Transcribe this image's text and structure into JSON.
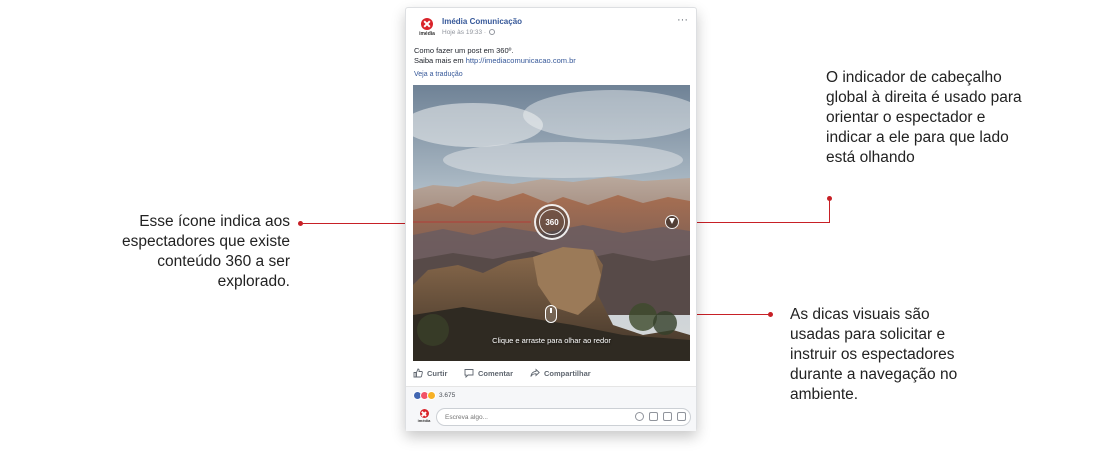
{
  "annotations": {
    "left": "Esse ícone indica aos espectadores que existe conteúdo 360 a ser explorado.",
    "top_right": "O indicador de cabeçalho global à direita é usado para orientar o espectador e indicar a ele para que lado está olhando",
    "bottom_right": "As dicas visuais são usadas para solicitar e instruir os espectadores durante a navegação no ambiente."
  },
  "post": {
    "avatar_brand": "imédia",
    "page_name": "Imédia Comunicação",
    "time": "Hoje às 19:33 · ",
    "more": "···",
    "text_line1": "Como fazer um post em 360º.",
    "text_line2_prefix": "Saiba mais em ",
    "link": "http://imediacomunicacao.com.br",
    "translate": "Veja a tradução"
  },
  "media": {
    "badge": "360",
    "hint": "Clique e arraste para olhar ao redor"
  },
  "actions": {
    "like": "Curtir",
    "comment": "Comentar",
    "share": "Compartilhar"
  },
  "reactions": {
    "count": "3.675"
  },
  "comment": {
    "placeholder": "Escreva algo..."
  },
  "colors": {
    "accent": "#c72026",
    "link": "#365899",
    "like": "#4267b2"
  }
}
